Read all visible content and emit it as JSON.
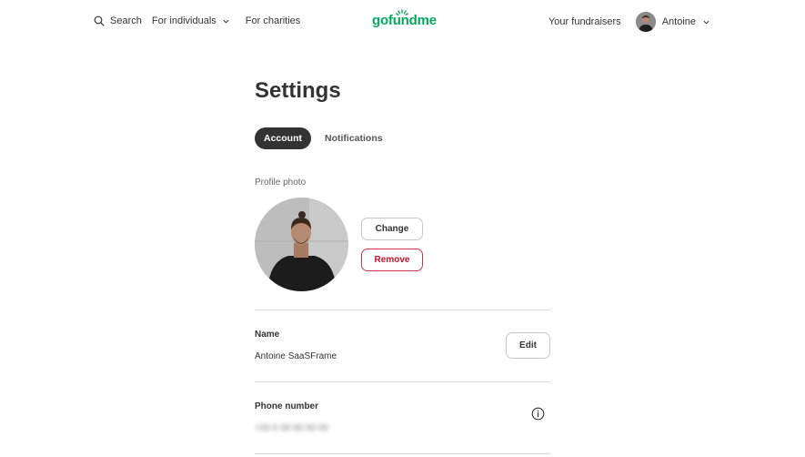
{
  "header": {
    "search_label": "Search",
    "for_individuals_label": "For individuals",
    "for_charities_label": "For charities",
    "logo_text": "gofundme",
    "your_fundraisers_label": "Your fundraisers",
    "user_name": "Antoine"
  },
  "main": {
    "title": "Settings",
    "tabs": [
      {
        "label": "Account",
        "active": true
      },
      {
        "label": "Notifications",
        "active": false
      }
    ],
    "profile_photo": {
      "label": "Profile photo",
      "change_label": "Change",
      "remove_label": "Remove"
    },
    "name_field": {
      "label": "Name",
      "value": "Antoine SaaSFrame",
      "edit_label": "Edit"
    },
    "phone_field": {
      "label": "Phone number",
      "value": "+33 6 00 00 00 00"
    }
  },
  "colors": {
    "brand_green": "#02a95c",
    "dark_pill": "#333333",
    "danger_red": "#c8102e"
  }
}
